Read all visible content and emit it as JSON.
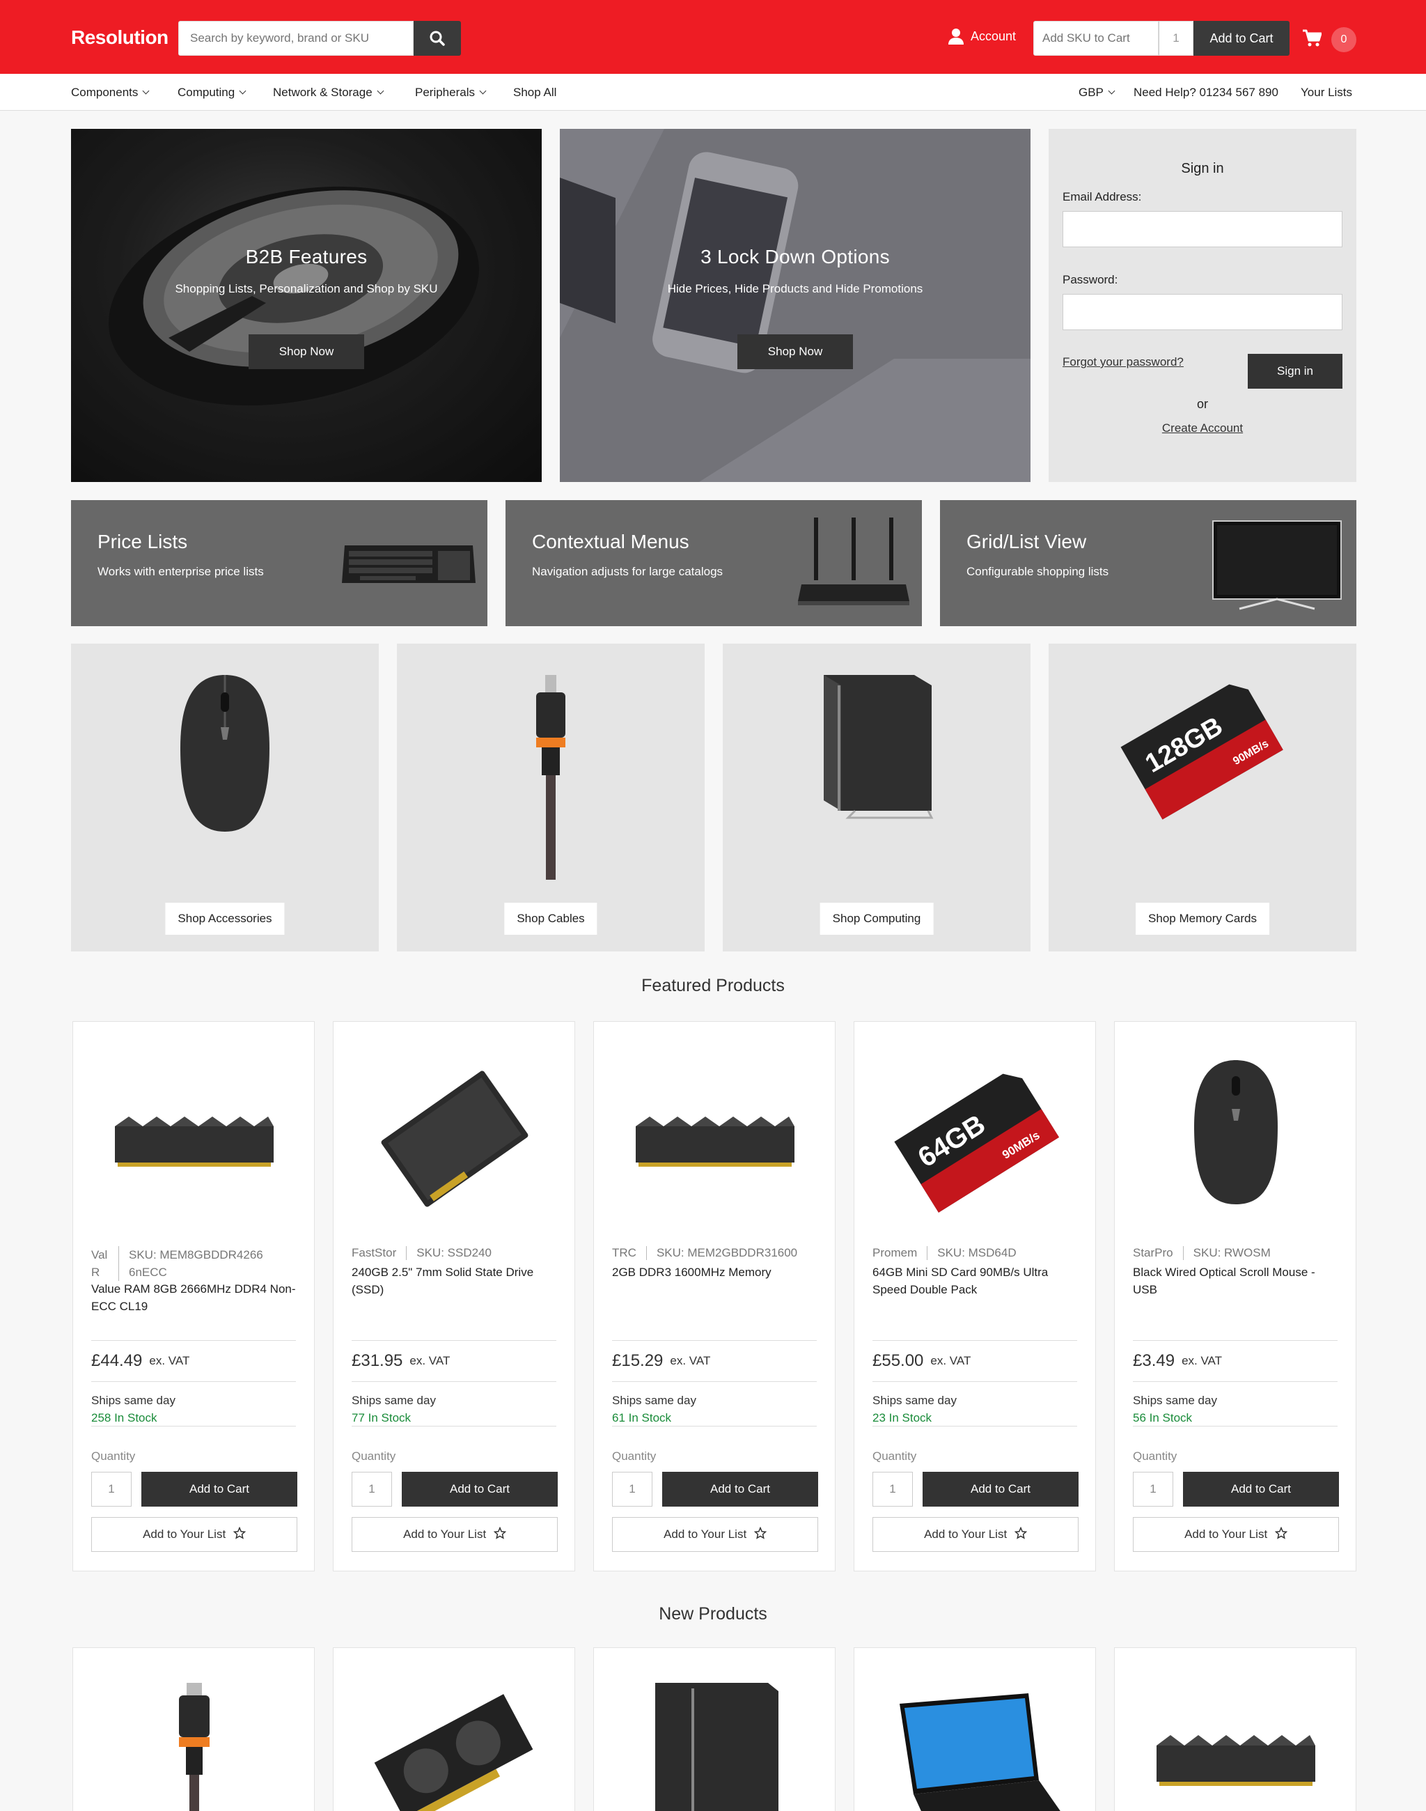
{
  "header": {
    "logo": "Resolution",
    "search_placeholder": "Search by keyword, brand or SKU",
    "account": "Account",
    "sku_placeholder": "Add SKU to Cart",
    "sku_qty": "1",
    "add_to_cart": "Add to Cart",
    "cart_count": "0",
    "brand_color": "#ee1c24"
  },
  "nav": {
    "left": [
      "Components",
      "Computing",
      "Network & Storage",
      "Peripherals",
      "Shop All"
    ],
    "currency": "GBP",
    "help": "Need Help? 01234 567 890",
    "lists": "Your Lists"
  },
  "hero": [
    {
      "title": "B2B Features",
      "subtitle": "Shopping Lists, Personalization and Shop by SKU",
      "button": "Shop Now"
    },
    {
      "title": "3 Lock Down Options",
      "subtitle": "Hide Prices, Hide Products and Hide Promotions",
      "button": "Shop Now"
    }
  ],
  "signin": {
    "title": "Sign in",
    "email_label": "Email Address:",
    "password_label": "Password:",
    "forgot": "Forgot your password?",
    "button": "Sign in",
    "or": "or",
    "create": "Create Account"
  },
  "features": [
    {
      "title": "Price Lists",
      "subtitle": "Works with enterprise price lists",
      "icon": "keyboard-icon"
    },
    {
      "title": "Contextual Menus",
      "subtitle": "Navigation adjusts for large catalogs",
      "icon": "router-icon"
    },
    {
      "title": "Grid/List View",
      "subtitle": "Configurable shopping lists",
      "icon": "monitor-icon"
    }
  ],
  "categories": [
    {
      "label": "Shop Accessories",
      "icon": "mouse-icon"
    },
    {
      "label": "Shop Cables",
      "icon": "cable-icon"
    },
    {
      "label": "Shop Computing",
      "icon": "pc-case-icon"
    },
    {
      "label": "Shop Memory Cards",
      "icon": "memory-card-icon"
    }
  ],
  "featured": {
    "title": "Featured Products",
    "products": [
      {
        "brand": "Val R",
        "sku": "SKU: MEM8GBDDR42666nECC",
        "name": "Value RAM 8GB 2666MHz DDR4 Non-ECC CL19",
        "price": "£44.49",
        "vat": "ex. VAT",
        "ships": "Ships same day",
        "stock": "258 In Stock",
        "qty_label": "Quantity",
        "qty": "1",
        "add": "Add to Cart",
        "list": "Add to Your List",
        "icon": "ram-icon"
      },
      {
        "brand": "FastStor",
        "sku": "SKU: SSD240",
        "name": "240GB 2.5\" 7mm Solid State Drive (SSD)",
        "price": "£31.95",
        "vat": "ex. VAT",
        "ships": "Ships same day",
        "stock": "77 In Stock",
        "qty_label": "Quantity",
        "qty": "1",
        "add": "Add to Cart",
        "list": "Add to Your List",
        "icon": "ssd-icon"
      },
      {
        "brand": "TRC",
        "sku": "SKU: MEM2GBDDR31600",
        "name": "2GB DDR3 1600MHz Memory",
        "price": "£15.29",
        "vat": "ex. VAT",
        "ships": "Ships same day",
        "stock": "61 In Stock",
        "qty_label": "Quantity",
        "qty": "1",
        "add": "Add to Cart",
        "list": "Add to Your List",
        "icon": "ram-icon"
      },
      {
        "brand": "Promem",
        "sku": "SKU: MSD64D",
        "name": "64GB Mini SD Card 90MB/s Ultra Speed Double Pack",
        "price": "£55.00",
        "vat": "ex. VAT",
        "ships": "Ships same day",
        "stock": "23 In Stock",
        "qty_label": "Quantity",
        "qty": "1",
        "add": "Add to Cart",
        "list": "Add to Your List",
        "icon": "memory-card-icon"
      },
      {
        "brand": "StarPro",
        "sku": "SKU: RWOSM",
        "name": "Black Wired Optical Scroll Mouse - USB",
        "price": "£3.49",
        "vat": "ex. VAT",
        "ships": "Ships same day",
        "stock": "56 In Stock",
        "qty_label": "Quantity",
        "qty": "1",
        "add": "Add to Cart",
        "list": "Add to Your List",
        "icon": "mouse-icon"
      }
    ]
  },
  "new_products": {
    "title": "New Products",
    "icons": [
      "cable-icon",
      "graphics-card-icon",
      "pc-case-icon",
      "laptop-icon",
      "ram-icon"
    ]
  },
  "card_labels": {
    "memory_128": "128GB",
    "memory_64": "64GB",
    "speed": "90MB/s"
  }
}
